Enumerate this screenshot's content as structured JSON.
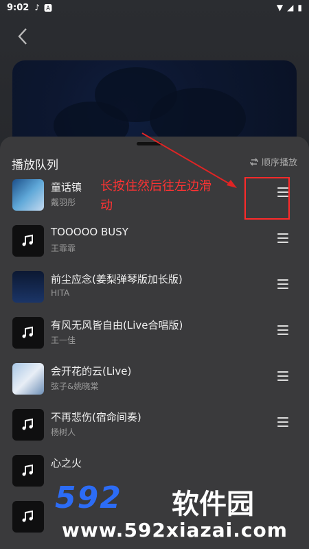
{
  "status": {
    "time": "9:02",
    "icons": [
      "music-note-icon",
      "a-icon"
    ],
    "right_icons": [
      "wifi-icon",
      "signal-icon",
      "battery-icon"
    ]
  },
  "queue": {
    "title": "播放队列",
    "mode": "顺序播放",
    "items": [
      {
        "song": "童话镇",
        "artist": "戴羽彤",
        "thumb": "cover-art"
      },
      {
        "song": "TOOOOO BUSY",
        "artist": "王霏霏",
        "thumb": "music-note-icon"
      },
      {
        "song": "前尘应念(姜梨弹琴版加长版)",
        "artist": "HITA",
        "thumb": "cover-art"
      },
      {
        "song": "有风无风皆自由(Live合唱版)",
        "artist": "王一佳",
        "thumb": "music-note-icon"
      },
      {
        "song": "会开花的云(Live)",
        "artist": "弦子&姚晓棠",
        "thumb": "cover-art"
      },
      {
        "song": "不再悲伤(宿命间奏)",
        "artist": "杨树人",
        "thumb": "music-note-icon"
      },
      {
        "song": "心之火",
        "artist": "",
        "thumb": "music-note-icon"
      },
      {
        "song": "",
        "artist": "",
        "thumb": "music-note-icon"
      }
    ]
  },
  "annotation": {
    "text": "长按住然后往左边滑动",
    "color": "#ff3333"
  },
  "watermark": {
    "logo": "592",
    "cn": "软件园",
    "url": "www.592xiazai.com"
  },
  "colors": {
    "sheet": "#3a3a3c",
    "accent_red": "#ff2a2a",
    "logo_blue": "#2c6cf6"
  }
}
